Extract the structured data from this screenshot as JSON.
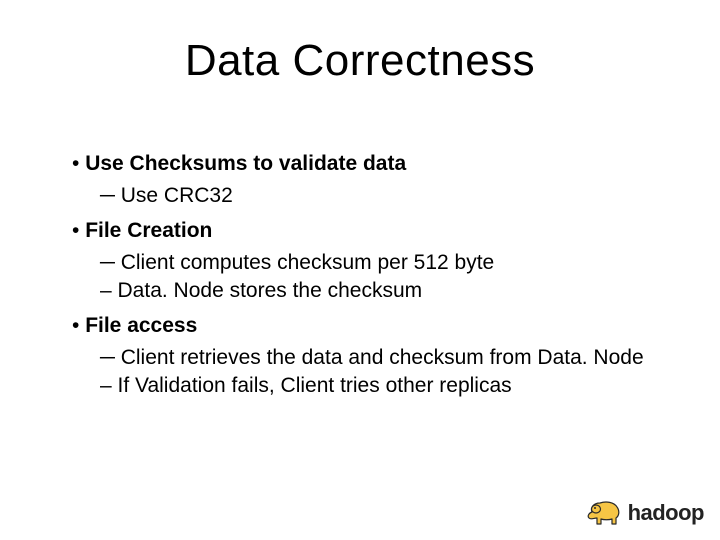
{
  "title": "Data Correctness",
  "bullets": {
    "b1": "Use Checksums to validate data",
    "b1_sub1": "Use CRC32",
    "b2": "File Creation",
    "b2_sub1": "Client computes checksum per 512 byte",
    "b2_sub2": "Data. Node stores the checksum",
    "b3": "File access",
    "b3_sub1": "Client retrieves the data and checksum from Data. Node",
    "b3_sub2": "If Validation fails, Client tries other replicas"
  },
  "logo": {
    "text": "hadoop",
    "elephant_color": "#f6c545",
    "elephant_outline": "#2a2a2a"
  }
}
